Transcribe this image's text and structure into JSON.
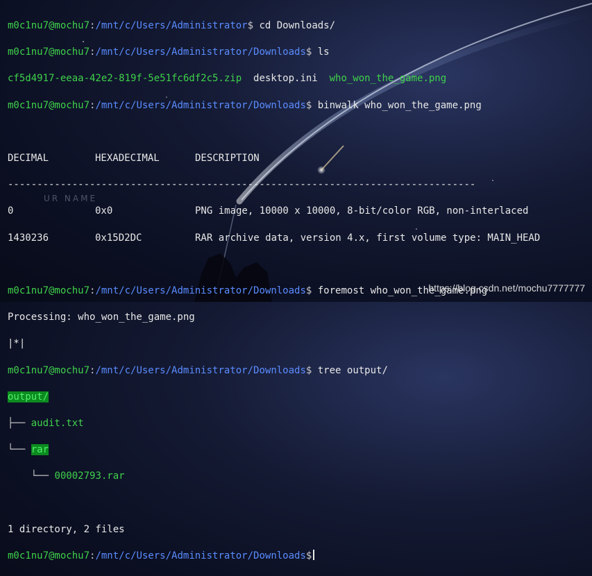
{
  "terminal": {
    "prompt_user": "m0c1nu7@mochu7",
    "path_users": "/mnt/c/Users/Administrator",
    "path_downloads": "/mnt/c/Users/Administrator/Downloads",
    "cmd_cd": "cd Downloads/",
    "cmd_ls": "ls",
    "ls_output": {
      "file1": "cf5d4917-eeaa-42e2-819f-5e51fc6df2c5.zip",
      "file2": "desktop.ini",
      "file3": "who_won_the_game.png"
    },
    "cmd_binwalk": "binwalk who_won_the_game.png",
    "binwalk_table": {
      "headers": [
        "DECIMAL",
        "HEXADECIMAL",
        "DESCRIPTION"
      ],
      "rule": "--------------------------------------------------------------------------------",
      "rows": [
        [
          "0",
          "0x0",
          "PNG image, 10000 x 10000, 8-bit/color RGB, non-interlaced"
        ],
        [
          "1430236",
          "0x15D2DC",
          "RAR archive data, version 4.x, first volume type: MAIN_HEAD"
        ]
      ]
    },
    "cmd_foremost": "foremost who_won_the_game.png",
    "foremost_processing": "Processing: who_won_the_game.png",
    "foremost_progress": "|*|",
    "cmd_tree": "tree output/",
    "tree": {
      "root": "output/",
      "item1": "audit.txt",
      "item2": "rar",
      "item2_child": "00002793.rar",
      "summary": "1 directory, 2 files"
    }
  },
  "background_text": "UR NAME",
  "watermark": "https://blog.csdn.net/mochu7777777"
}
